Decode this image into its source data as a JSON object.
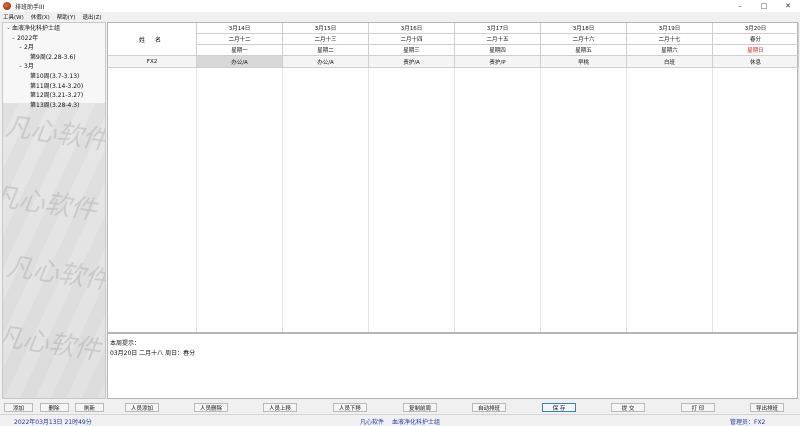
{
  "window": {
    "title": "排班助手III",
    "controls": {
      "minimize": "–",
      "maximize": "□",
      "close": "✕"
    }
  },
  "menu": [
    "工具(W)",
    "休假(X)",
    "帮助(Y)",
    "退出(Z)"
  ],
  "tree": [
    {
      "label": "血液净化科护士组",
      "level": 0,
      "chevron": "⌄"
    },
    {
      "label": "2022年",
      "level": 1,
      "chevron": "⌄"
    },
    {
      "label": "2月",
      "level": 2,
      "chevron": "⌄"
    },
    {
      "label": "第9周(2.28-3.6)",
      "level": 3,
      "chevron": ""
    },
    {
      "label": "3月",
      "level": 2,
      "chevron": "⌄"
    },
    {
      "label": "第10周(3.7-3.13)",
      "level": 3,
      "chevron": ""
    },
    {
      "label": "第11周(3.14-3.20)",
      "level": 3,
      "chevron": ""
    },
    {
      "label": "第12周(3.21-3.27)",
      "level": 3,
      "chevron": ""
    },
    {
      "label": "第13周(3.28-4.3)",
      "level": 3,
      "chevron": ""
    }
  ],
  "left_buttons": {
    "add": "添加",
    "delete": "删除",
    "refresh": "刷新"
  },
  "grid": {
    "name_header": "姓 名",
    "days": [
      {
        "date": "3月14日",
        "lunar": "二月十二",
        "weekday": "星期一",
        "holiday": false
      },
      {
        "date": "3月15日",
        "lunar": "二月十三",
        "weekday": "星期二",
        "holiday": false
      },
      {
        "date": "3月16日",
        "lunar": "二月十四",
        "weekday": "星期三",
        "holiday": false
      },
      {
        "date": "3月17日",
        "lunar": "二月十五",
        "weekday": "星期四",
        "holiday": false
      },
      {
        "date": "3月18日",
        "lunar": "二月十六",
        "weekday": "星期五",
        "holiday": false
      },
      {
        "date": "3月19日",
        "lunar": "二月十七",
        "weekday": "星期六",
        "holiday": false
      },
      {
        "date": "3月20日",
        "lunar": "春分",
        "weekday": "星期日",
        "holiday": true
      }
    ],
    "rows": [
      {
        "name": "FX2",
        "shifts": [
          "办公/A",
          "办公/A",
          "责护/A",
          "责护/P",
          "早桃",
          "白班",
          "休息"
        ],
        "selected_index": 0
      }
    ],
    "holiday_color": "#e02020"
  },
  "tips": {
    "title": "本周提示：",
    "line": "03月20日  二月十八 周日：春分"
  },
  "main_buttons": [
    "人员添加",
    "人员删除",
    "人员上移",
    "人员下移",
    "复制前周",
    "自动排班",
    "保 存",
    "提 交",
    "打 印",
    "导出排班"
  ],
  "status": {
    "datetime": "2022年03月13日  21时49分",
    "company": "凡心软件",
    "group": "血液净化科护士组",
    "admin": "管理员：FX2"
  }
}
